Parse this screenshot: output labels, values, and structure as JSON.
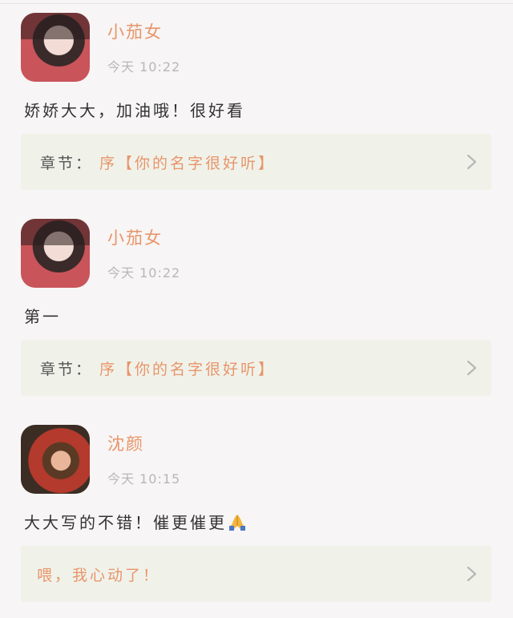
{
  "comments": [
    {
      "username": "小茄女",
      "time": "今天 10:22",
      "text": "娇娇大大，加油哦！很好看",
      "chapter_label": "章节：",
      "chapter_title": "序【你的名字很好听】",
      "avatar": "avatar-woman-red"
    },
    {
      "username": "小茄女",
      "time": "今天 10:22",
      "text": "第一",
      "chapter_label": "章节：",
      "chapter_title": "序【你的名字很好听】",
      "avatar": "avatar-woman-red"
    },
    {
      "username": "沈颜",
      "time": "今天 10:15",
      "text": "大大写的不错！催更催更",
      "emoji": "folded-hands",
      "chapter_label": "",
      "chapter_title": "喂，我心动了！",
      "avatar": "avatar-woman-cafe"
    }
  ],
  "colors": {
    "accent": "#e8956a",
    "background": "#f7f5f5",
    "card": "#f0f2ea",
    "muted": "#b9b6b6"
  }
}
